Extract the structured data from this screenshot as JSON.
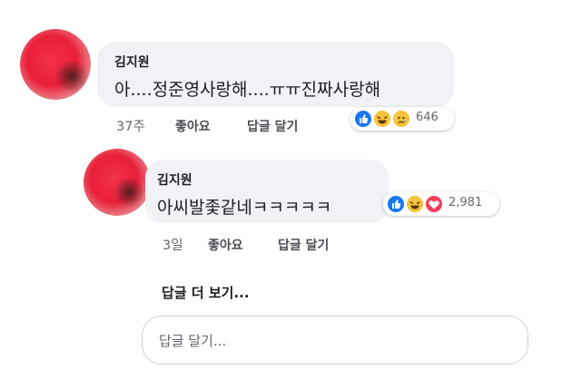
{
  "comment": {
    "author": "김지원",
    "text": "아....정준영사랑해....ㅠㅠ진짜사랑해",
    "time": "37주",
    "like_label": "좋아요",
    "reply_label": "답글 달기",
    "reactions": [
      "like",
      "haha",
      "sad"
    ],
    "reaction_count": "646"
  },
  "reply": {
    "author": "김지원",
    "text": "아씨발좇같네ㅋㅋㅋㅋㅋ",
    "time": "3일",
    "like_label": "좋아요",
    "reply_label": "답글 달기",
    "reactions": [
      "like",
      "haha",
      "love"
    ],
    "reaction_count": "2,981"
  },
  "more_replies_label": "답글 더 보기...",
  "reply_input": {
    "placeholder": "답글 달기..."
  },
  "colors": {
    "like": "#1877f2",
    "haha": "#f7c33b",
    "love": "#f33e58",
    "bubble": "#f0f2f5"
  }
}
